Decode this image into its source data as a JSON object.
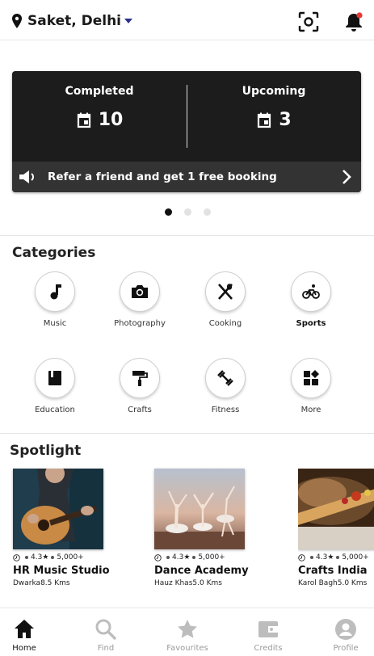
{
  "header": {
    "location": "Saket, Delhi",
    "icons": [
      "location-pin-icon",
      "scan-icon",
      "bell-icon"
    ],
    "notification_dot_color": "#e53935"
  },
  "stats": {
    "completed": {
      "label": "Completed",
      "value": "10"
    },
    "upcoming": {
      "label": "Upcoming",
      "value": "3"
    },
    "refer_text": "Refer a friend and get 1 free booking",
    "carousel": {
      "pages": 3,
      "active": 1
    }
  },
  "categories": {
    "title": "Categories",
    "items": [
      {
        "label": "Music",
        "icon": "music-note-icon"
      },
      {
        "label": "Photography",
        "icon": "camera-icon"
      },
      {
        "label": "Cooking",
        "icon": "cutlery-icon"
      },
      {
        "label": "Sports",
        "icon": "bicycle-icon"
      },
      {
        "label": "Education",
        "icon": "book-icon"
      },
      {
        "label": "Crafts",
        "icon": "paint-roller-icon"
      },
      {
        "label": "Fitness",
        "icon": "dumbbell-icon"
      },
      {
        "label": "More",
        "icon": "more-grid-icon"
      }
    ]
  },
  "spotlight": {
    "title": "Spotlight",
    "items": [
      {
        "rating": "4.3",
        "count": "5,000+",
        "name": "HR Music Studio",
        "area": "Dwarka",
        "distance": "8.5 Kms"
      },
      {
        "rating": "4.3",
        "count": "5,000+",
        "name": "Dance Academy",
        "area": "Hauz Khas",
        "distance": "5.0 Kms"
      },
      {
        "rating": "4.3",
        "count": "5,000+",
        "name": "Crafts India",
        "area": "Karol Bagh",
        "distance": "5.0 Kms"
      }
    ]
  },
  "nav": {
    "items": [
      {
        "label": "Home",
        "icon": "home-icon",
        "active": true
      },
      {
        "label": "Find",
        "icon": "search-icon",
        "active": false
      },
      {
        "label": "Favourites",
        "icon": "star-icon",
        "active": false
      },
      {
        "label": "Credits",
        "icon": "wallet-icon",
        "active": false
      },
      {
        "label": "Profile",
        "icon": "profile-icon",
        "active": false
      }
    ]
  }
}
